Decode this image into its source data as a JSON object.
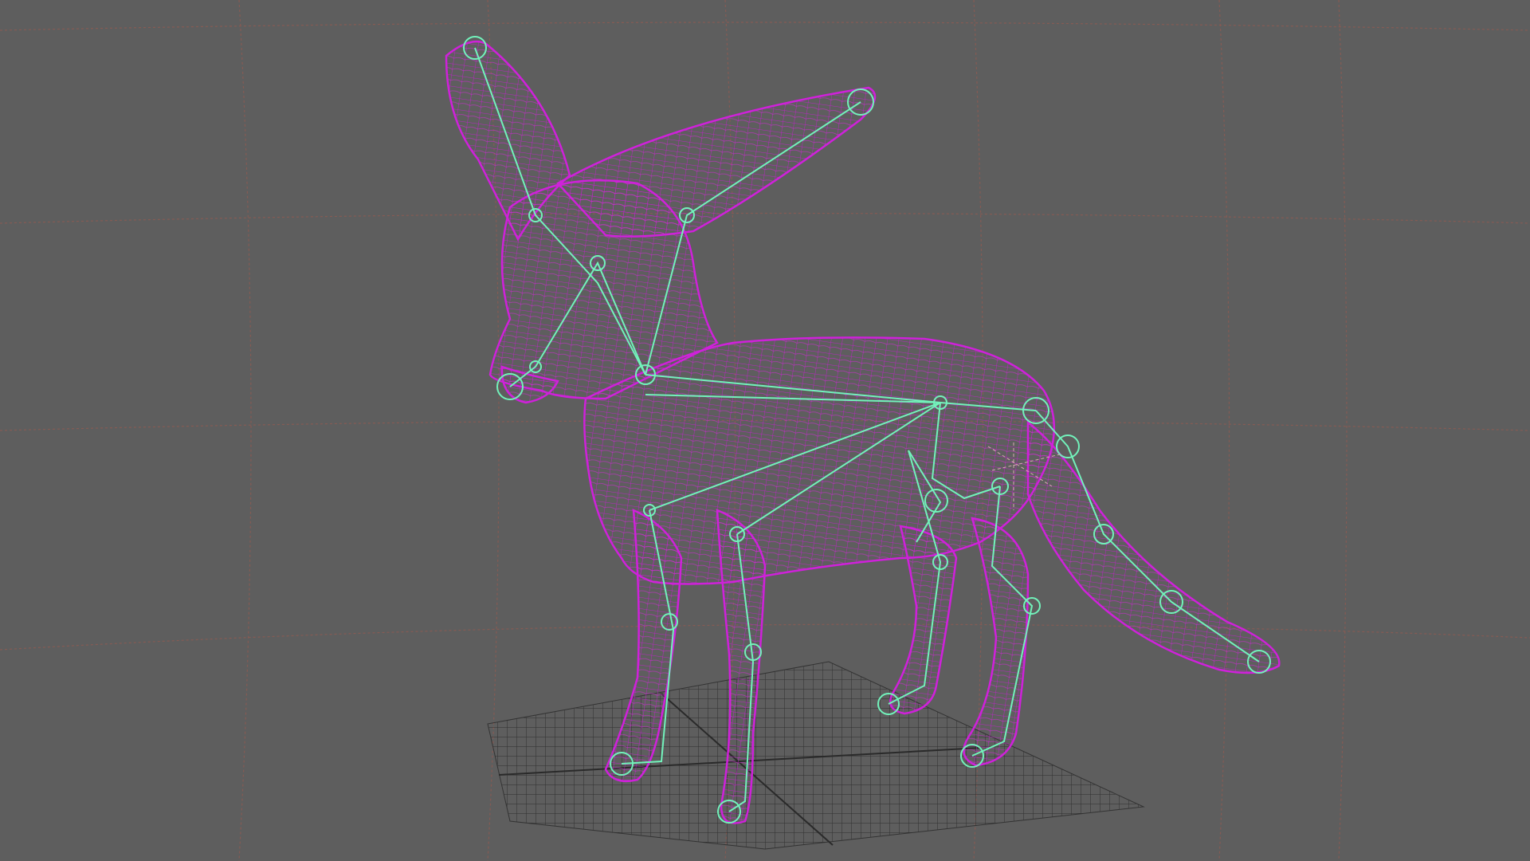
{
  "viewport": {
    "background_color": "#5e5e5e",
    "view_grid_color": "#8c5a52",
    "ground_grid_color": "#3a3a3a",
    "mesh_wireframe_color": "#cc1fd6",
    "joint_color": "#6ff0b4",
    "joint_line_color": "#7dffd0"
  },
  "scene": {
    "model": "fox-mesh-wireframe",
    "rig": "fox-skeleton-joints"
  }
}
